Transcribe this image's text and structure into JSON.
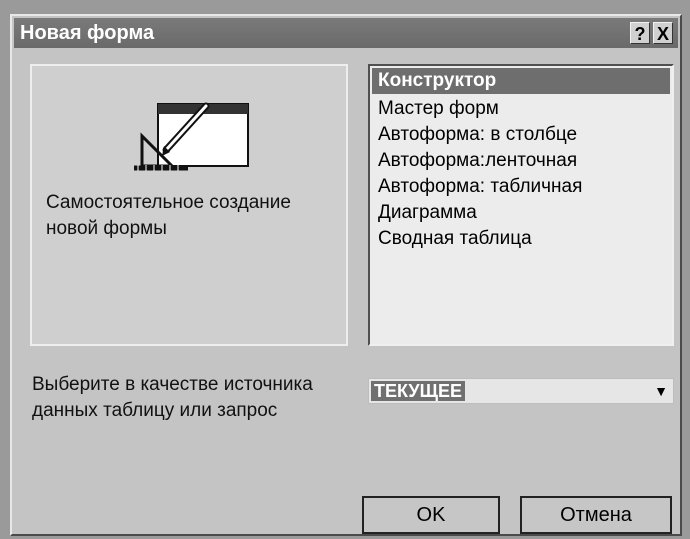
{
  "window": {
    "title": "Новая форма",
    "help_label": "?",
    "close_label": "X"
  },
  "preview": {
    "description": "Самостоятельное создание новой формы",
    "icon": "form-design-icon"
  },
  "form_types": {
    "items": [
      {
        "label": "Конструктор",
        "selected": true
      },
      {
        "label": "Мастер форм",
        "selected": false
      },
      {
        "label": "Автоформа: в столбце",
        "selected": false
      },
      {
        "label": "Автоформа:ленточная",
        "selected": false
      },
      {
        "label": "Автоформа: табличная",
        "selected": false
      },
      {
        "label": "Диаграмма",
        "selected": false
      },
      {
        "label": "Сводная таблица",
        "selected": false
      }
    ]
  },
  "source": {
    "label": "Выберите в качестве источника данных таблицу или запрос",
    "value": "ТЕКУЩЕЕ",
    "arrow": "▼"
  },
  "buttons": {
    "ok_label": "OK",
    "cancel_label": "Отмена"
  }
}
